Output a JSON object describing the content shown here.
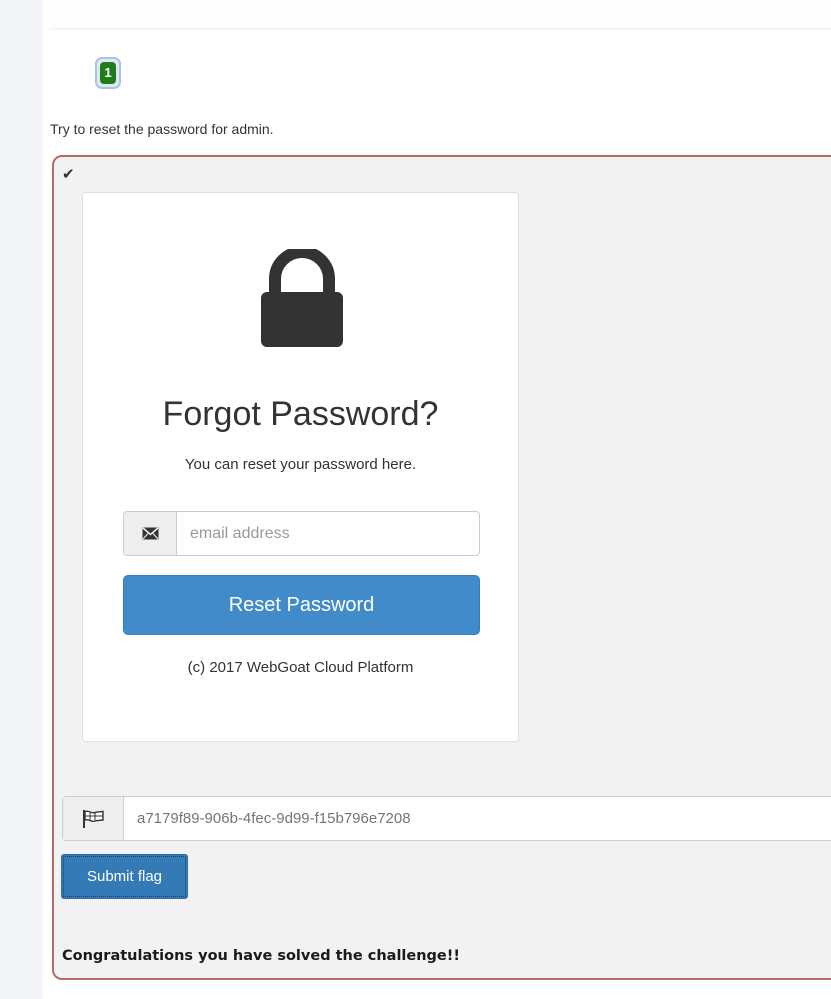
{
  "lesson": {
    "page_number": "1",
    "instruction": "Try to reset the password for admin."
  },
  "challenge": {
    "status_icon": "check-icon",
    "lock_icon": "lock-icon",
    "title": "Forgot Password?",
    "subtitle": "You can reset your password here.",
    "email_icon": "envelope-icon",
    "email_placeholder": "email address",
    "reset_button_label": "Reset Password",
    "copyright": "(c) 2017 WebGoat Cloud Platform"
  },
  "flag": {
    "flag_icon": "flag-icon",
    "placeholder": "a7179f89-906b-4fec-9d99-f15b796e7208",
    "submit_label": "Submit flag",
    "success_message": "Congratulations you have solved the challenge!!"
  },
  "colors": {
    "accent": "#428bca",
    "submit": "#337ab7",
    "badge_success": "#1f7d17",
    "container_border": "#b86b6b"
  }
}
